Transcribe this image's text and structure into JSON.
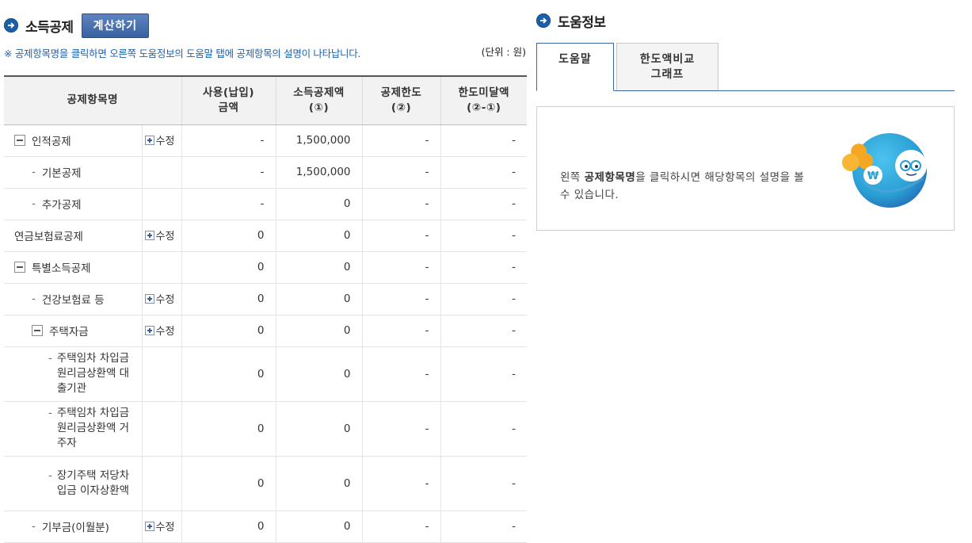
{
  "left": {
    "title": "소득공제",
    "calc_button": "계산하기",
    "notice": "※ 공제항목명을 클릭하면 오른쪽 도움정보의 도움말 탭에 공제항목의 설명이 나타납니다.",
    "unit": "(단위 : 원)",
    "headers": {
      "name": "공제항목명",
      "use_l1": "사용(납입)",
      "use_l2": "금액",
      "ded_l1": "소득공제액",
      "ded_l2": "(①)",
      "lim_l1": "공제한도",
      "lim_l2": "(②)",
      "rem_l1": "한도미달액",
      "rem_l2": "(②-①)"
    },
    "edit_label": "수정",
    "rows": [
      {
        "name": "인적공제",
        "use": "-",
        "ded": "1,500,000",
        "lim": "-",
        "rem": "-"
      },
      {
        "name": "기본공제",
        "use": "-",
        "ded": "1,500,000",
        "lim": "-",
        "rem": "-"
      },
      {
        "name": "추가공제",
        "use": "-",
        "ded": "0",
        "lim": "-",
        "rem": "-"
      },
      {
        "name": "연금보험료공제",
        "use": "0",
        "ded": "0",
        "lim": "-",
        "rem": "-"
      },
      {
        "name": "특별소득공제",
        "use": "0",
        "ded": "0",
        "lim": "-",
        "rem": "-"
      },
      {
        "name": "건강보험료 등",
        "use": "0",
        "ded": "0",
        "lim": "-",
        "rem": "-"
      },
      {
        "name": "주택자금",
        "use": "0",
        "ded": "0",
        "lim": "-",
        "rem": "-"
      },
      {
        "name": "주택임차 차입금 원리금상환액 대출기관",
        "use": "0",
        "ded": "0",
        "lim": "-",
        "rem": "-"
      },
      {
        "name": "주택임차 차입금 원리금상환액 거주자",
        "use": "0",
        "ded": "0",
        "lim": "-",
        "rem": "-"
      },
      {
        "name": "장기주택 저당차입금 이자상환액",
        "use": "0",
        "ded": "0",
        "lim": "-",
        "rem": "-"
      },
      {
        "name": "기부금(이월분)",
        "use": "0",
        "ded": "0",
        "lim": "-",
        "rem": "-"
      }
    ]
  },
  "right": {
    "title": "도움정보",
    "tabs": [
      {
        "label": "도움말"
      },
      {
        "label_l1": "한도액비교",
        "label_l2": "그래프"
      }
    ],
    "help_prefix": "왼쪽 ",
    "help_bold": "공제항목명",
    "help_suffix": "을 클릭하시면 해당항목의 설명을 볼 수 있습니다.",
    "won_symbol": "₩"
  },
  "colors": {
    "accent_blue": "#1d5fa6",
    "button_blue": "#3a62a0",
    "notice_blue": "#1d62b0",
    "mascot_blue": "#2a9fd4",
    "mascot_orange": "#f5a623"
  }
}
